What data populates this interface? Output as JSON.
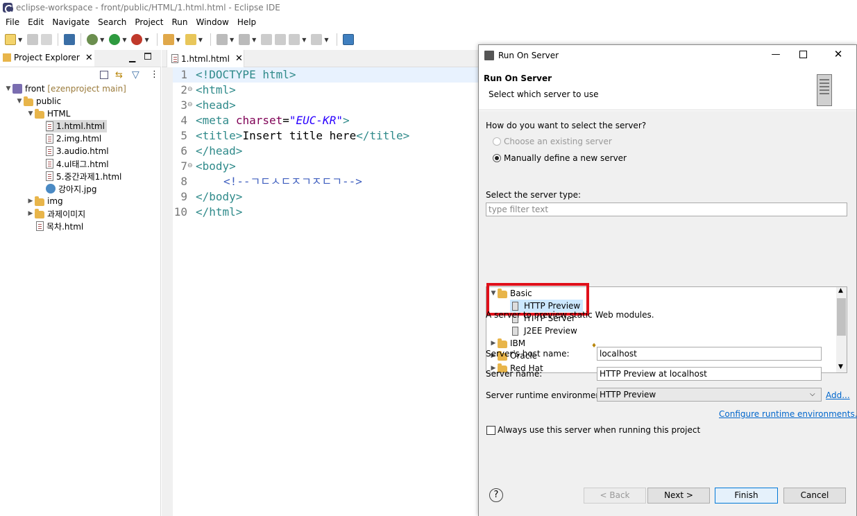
{
  "window": {
    "title": "eclipse-workspace - front/public/HTML/1.html.html - Eclipse IDE"
  },
  "menu": [
    "File",
    "Edit",
    "Navigate",
    "Search",
    "Project",
    "Run",
    "Window",
    "Help"
  ],
  "project_explorer": {
    "tab_label": "Project Explorer",
    "tree": [
      {
        "label": "front",
        "suffix": "[ezenproject main]",
        "icon": "project-icon"
      },
      {
        "label": "public",
        "icon": "folder-icon"
      },
      {
        "label": "HTML",
        "icon": "folder-icon"
      },
      {
        "label": "1.html.html",
        "icon": "html-file-icon"
      },
      {
        "label": "2.img.html",
        "icon": "html-file-icon"
      },
      {
        "label": "3.audio.html",
        "icon": "html-file-icon"
      },
      {
        "label": "4.ul태그.html",
        "icon": "html-file-icon"
      },
      {
        "label": "5.중간과제1.html",
        "icon": "html-file-icon"
      },
      {
        "label": "강아지.jpg",
        "icon": "image-file-icon"
      },
      {
        "label": "img",
        "icon": "folder-icon"
      },
      {
        "label": "과제이미지",
        "icon": "folder-icon"
      },
      {
        "label": "목차.html",
        "icon": "html-file-icon"
      }
    ]
  },
  "editor": {
    "tab_label": "1.html.html",
    "line_numbers": [
      "1",
      "2",
      "3",
      "4",
      "5",
      "6",
      "7",
      "8",
      "9",
      "10"
    ],
    "lines": {
      "l1": "<!DOCTYPE html>",
      "l2": "<html>",
      "l3": "<head>",
      "l4_tag": "<meta",
      "l4_attr": "charset",
      "l4_eq": "=",
      "l4_val": "\"EUC-KR\"",
      "l4_end": ">",
      "l5_open": "<title>",
      "l5_text": "Insert title here",
      "l5_close": "</title>",
      "l6": "</head>",
      "l7": "<body>",
      "l8": "<!--ㄱㄷㅅㄷㅈㄱㅈㄷㄱ-->",
      "l9": "</body>",
      "l10": "</html>"
    }
  },
  "dialog": {
    "title": "Run On Server",
    "header_title": "Run On Server",
    "header_subtitle": "Select which server to use",
    "question": "How do you want to select the server?",
    "radio_existing": "Choose an existing server",
    "radio_manual": "Manually define a new server",
    "server_type_label": "Select the server type:",
    "filter_placeholder": "type filter text",
    "server_tree": {
      "basic": "Basic",
      "http_preview": "HTTP Preview",
      "http_server": "HTTP Server",
      "j2ee_preview": "J2EE Preview",
      "ibm": "IBM",
      "oracle": "Oracle",
      "red_hat": "Red Hat"
    },
    "server_description": "A server to preview static Web modules.",
    "host_label": "Server's host name:",
    "host_value": "localhost",
    "name_label": "Server name:",
    "name_value": "HTTP Preview at localhost",
    "runtime_label": "Server runtime environment:",
    "runtime_value": "HTTP Preview",
    "add_link": "Add...",
    "configure_link": "Configure runtime environments...",
    "always_use": "Always use this server when running this project",
    "buttons": {
      "back": "< Back",
      "next": "Next >",
      "finish": "Finish",
      "cancel": "Cancel"
    },
    "selected_type": "HTTP Preview",
    "highlight_color": "#e0101a"
  }
}
